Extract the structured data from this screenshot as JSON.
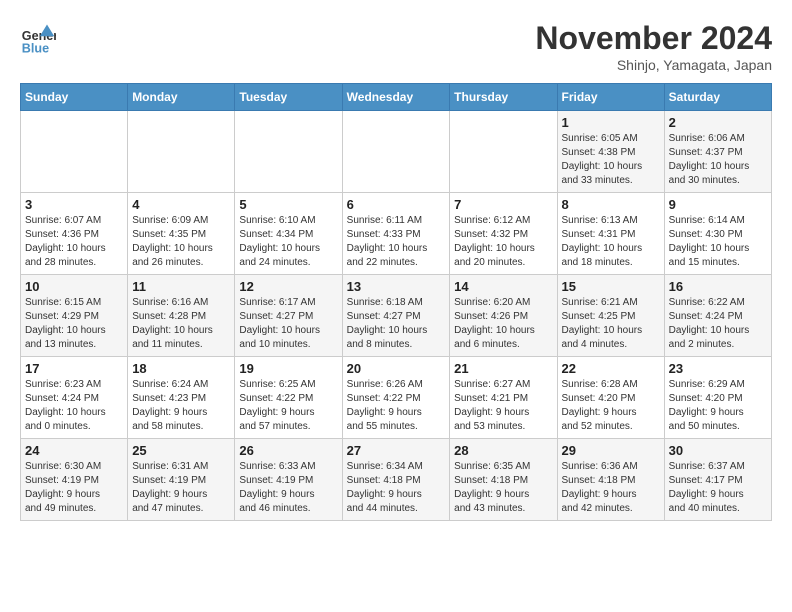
{
  "header": {
    "logo_line1": "General",
    "logo_line2": "Blue",
    "month": "November 2024",
    "location": "Shinjo, Yamagata, Japan"
  },
  "weekdays": [
    "Sunday",
    "Monday",
    "Tuesday",
    "Wednesday",
    "Thursday",
    "Friday",
    "Saturday"
  ],
  "weeks": [
    [
      {
        "day": "",
        "info": ""
      },
      {
        "day": "",
        "info": ""
      },
      {
        "day": "",
        "info": ""
      },
      {
        "day": "",
        "info": ""
      },
      {
        "day": "",
        "info": ""
      },
      {
        "day": "1",
        "info": "Sunrise: 6:05 AM\nSunset: 4:38 PM\nDaylight: 10 hours\nand 33 minutes."
      },
      {
        "day": "2",
        "info": "Sunrise: 6:06 AM\nSunset: 4:37 PM\nDaylight: 10 hours\nand 30 minutes."
      }
    ],
    [
      {
        "day": "3",
        "info": "Sunrise: 6:07 AM\nSunset: 4:36 PM\nDaylight: 10 hours\nand 28 minutes."
      },
      {
        "day": "4",
        "info": "Sunrise: 6:09 AM\nSunset: 4:35 PM\nDaylight: 10 hours\nand 26 minutes."
      },
      {
        "day": "5",
        "info": "Sunrise: 6:10 AM\nSunset: 4:34 PM\nDaylight: 10 hours\nand 24 minutes."
      },
      {
        "day": "6",
        "info": "Sunrise: 6:11 AM\nSunset: 4:33 PM\nDaylight: 10 hours\nand 22 minutes."
      },
      {
        "day": "7",
        "info": "Sunrise: 6:12 AM\nSunset: 4:32 PM\nDaylight: 10 hours\nand 20 minutes."
      },
      {
        "day": "8",
        "info": "Sunrise: 6:13 AM\nSunset: 4:31 PM\nDaylight: 10 hours\nand 18 minutes."
      },
      {
        "day": "9",
        "info": "Sunrise: 6:14 AM\nSunset: 4:30 PM\nDaylight: 10 hours\nand 15 minutes."
      }
    ],
    [
      {
        "day": "10",
        "info": "Sunrise: 6:15 AM\nSunset: 4:29 PM\nDaylight: 10 hours\nand 13 minutes."
      },
      {
        "day": "11",
        "info": "Sunrise: 6:16 AM\nSunset: 4:28 PM\nDaylight: 10 hours\nand 11 minutes."
      },
      {
        "day": "12",
        "info": "Sunrise: 6:17 AM\nSunset: 4:27 PM\nDaylight: 10 hours\nand 10 minutes."
      },
      {
        "day": "13",
        "info": "Sunrise: 6:18 AM\nSunset: 4:27 PM\nDaylight: 10 hours\nand 8 minutes."
      },
      {
        "day": "14",
        "info": "Sunrise: 6:20 AM\nSunset: 4:26 PM\nDaylight: 10 hours\nand 6 minutes."
      },
      {
        "day": "15",
        "info": "Sunrise: 6:21 AM\nSunset: 4:25 PM\nDaylight: 10 hours\nand 4 minutes."
      },
      {
        "day": "16",
        "info": "Sunrise: 6:22 AM\nSunset: 4:24 PM\nDaylight: 10 hours\nand 2 minutes."
      }
    ],
    [
      {
        "day": "17",
        "info": "Sunrise: 6:23 AM\nSunset: 4:24 PM\nDaylight: 10 hours\nand 0 minutes."
      },
      {
        "day": "18",
        "info": "Sunrise: 6:24 AM\nSunset: 4:23 PM\nDaylight: 9 hours\nand 58 minutes."
      },
      {
        "day": "19",
        "info": "Sunrise: 6:25 AM\nSunset: 4:22 PM\nDaylight: 9 hours\nand 57 minutes."
      },
      {
        "day": "20",
        "info": "Sunrise: 6:26 AM\nSunset: 4:22 PM\nDaylight: 9 hours\nand 55 minutes."
      },
      {
        "day": "21",
        "info": "Sunrise: 6:27 AM\nSunset: 4:21 PM\nDaylight: 9 hours\nand 53 minutes."
      },
      {
        "day": "22",
        "info": "Sunrise: 6:28 AM\nSunset: 4:20 PM\nDaylight: 9 hours\nand 52 minutes."
      },
      {
        "day": "23",
        "info": "Sunrise: 6:29 AM\nSunset: 4:20 PM\nDaylight: 9 hours\nand 50 minutes."
      }
    ],
    [
      {
        "day": "24",
        "info": "Sunrise: 6:30 AM\nSunset: 4:19 PM\nDaylight: 9 hours\nand 49 minutes."
      },
      {
        "day": "25",
        "info": "Sunrise: 6:31 AM\nSunset: 4:19 PM\nDaylight: 9 hours\nand 47 minutes."
      },
      {
        "day": "26",
        "info": "Sunrise: 6:33 AM\nSunset: 4:19 PM\nDaylight: 9 hours\nand 46 minutes."
      },
      {
        "day": "27",
        "info": "Sunrise: 6:34 AM\nSunset: 4:18 PM\nDaylight: 9 hours\nand 44 minutes."
      },
      {
        "day": "28",
        "info": "Sunrise: 6:35 AM\nSunset: 4:18 PM\nDaylight: 9 hours\nand 43 minutes."
      },
      {
        "day": "29",
        "info": "Sunrise: 6:36 AM\nSunset: 4:18 PM\nDaylight: 9 hours\nand 42 minutes."
      },
      {
        "day": "30",
        "info": "Sunrise: 6:37 AM\nSunset: 4:17 PM\nDaylight: 9 hours\nand 40 minutes."
      }
    ]
  ]
}
